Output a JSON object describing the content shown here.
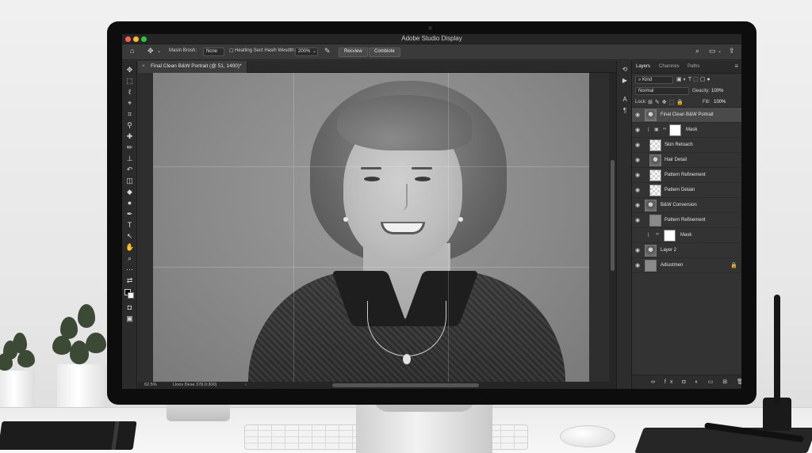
{
  "app": {
    "window_title": "Adobe Studio Display"
  },
  "options_bar": {
    "mask_brush_label": "Masin Brosh:",
    "mask_brush_value": "Ncne",
    "healing_label": "Heatling Sect Hasih Wesdth:",
    "healing_value": "200%",
    "review_button": "Recview",
    "combine_button": "Combiote"
  },
  "document": {
    "tab_title": "Final Clean B&W Portrait (@ 51, 1400)*",
    "close_glyph": "×"
  },
  "status": {
    "zoom": "62.5%",
    "doc_info": "Lloov Dese 378.0:300)",
    "arrow": "›"
  },
  "panels": {
    "tabs": [
      "Layers",
      "Chamnes",
      "Paths"
    ],
    "active_tab": "Layers",
    "kind_filter": "Kind",
    "blend_mode": "Normal",
    "opacity_label": "Oeacity:",
    "opacity_value": "100%",
    "lock_label": "Lock:",
    "fill_label": "Fill:",
    "fill_value": "100%"
  },
  "layers": [
    {
      "name": "Final Clean B&W Portrait",
      "thumb": "photo",
      "selected": true
    },
    {
      "name": "Mask",
      "thumb": "white",
      "indent": true
    },
    {
      "name": "Skin Retoach",
      "thumb": "check"
    },
    {
      "name": "Hair Detail",
      "thumb": "photo"
    },
    {
      "name": "Pattern Refinement",
      "thumb": "check"
    },
    {
      "name": "Pattern Detain",
      "thumb": "check"
    },
    {
      "name": "B&W Conversion",
      "thumb": "photo"
    },
    {
      "name": "Pattern Refinement",
      "thumb": "gray"
    },
    {
      "name": "Mask",
      "thumb": "white",
      "indent": true
    },
    {
      "name": "Layer 2",
      "thumb": "photo"
    },
    {
      "name": "Adiustmen",
      "thumb": "gray",
      "locked": true
    }
  ],
  "icons": {
    "eye": "eye-icon",
    "lock": "lock-icon",
    "home": "home-icon",
    "move": "move-icon",
    "search": "search-icon",
    "share": "share-icon"
  }
}
